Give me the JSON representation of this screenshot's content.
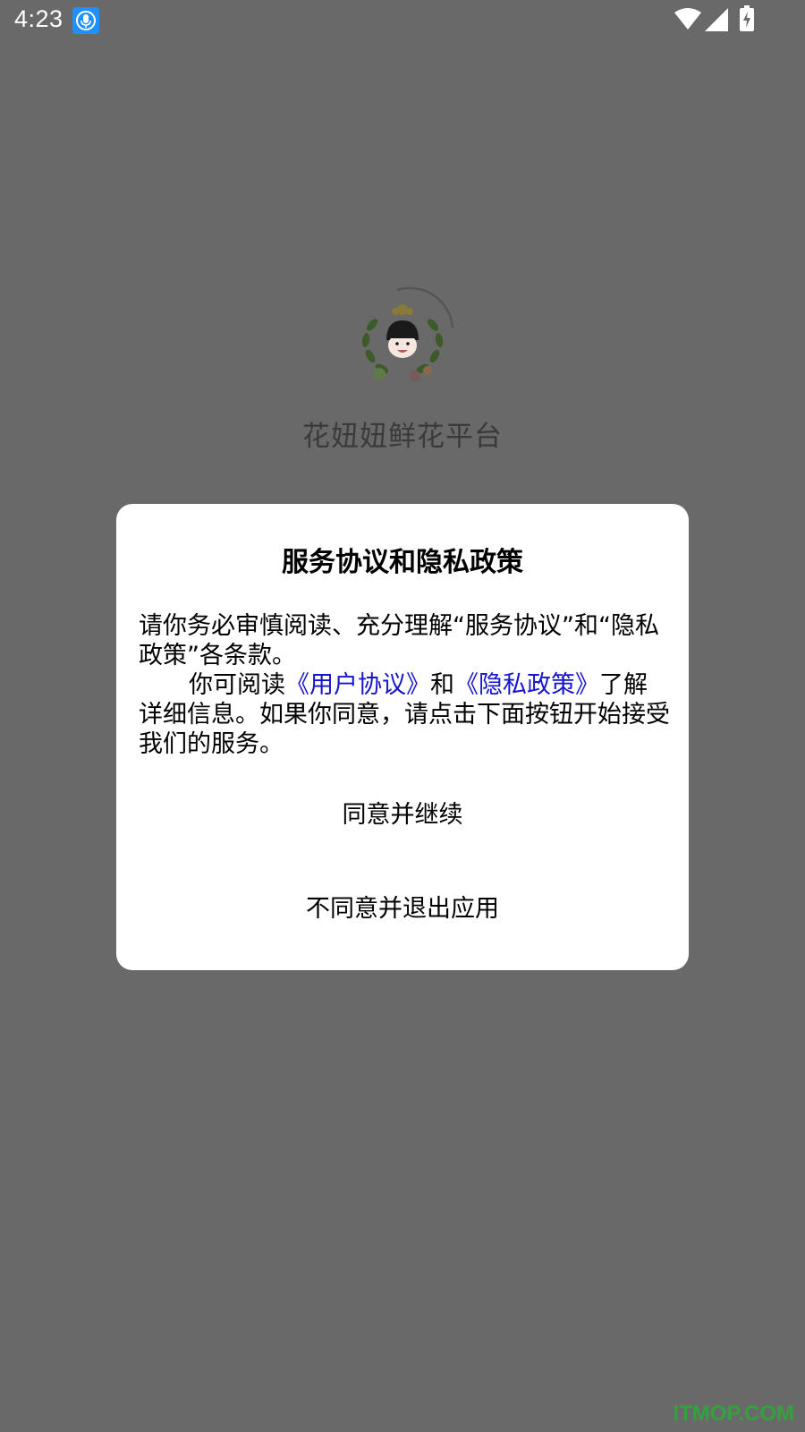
{
  "status_bar": {
    "time": "4:23",
    "icons": [
      "mic-icon",
      "wifi-icon",
      "signal-icon",
      "battery-charging-icon"
    ]
  },
  "splash": {
    "logo_icon": "cartoon-girl-flower-wreath-logo",
    "app_name": "花妞妞鲜花平台"
  },
  "dialog": {
    "title": "服务协议和隐私政策",
    "para1": "请你务必审慎阅读、充分理解“服务协议”和“隐私政策”各条款。",
    "para2_prefix": "你可阅读",
    "user_agreement_link": "《用户协议》",
    "para2_and": "和",
    "privacy_policy_link": "《隐私政策》",
    "para2_suffix": "了解详细信息。如果你同意，请点击下面按钮开始接受我们的服务。",
    "agree_button": "同意并继续",
    "disagree_button": "不同意并退出应用"
  },
  "colors": {
    "overlay_background": "#696969",
    "dialog_background": "#ffffff",
    "link": "#1515d0",
    "watermark": "#2fa83a"
  },
  "watermark": "ITMOP.COM"
}
